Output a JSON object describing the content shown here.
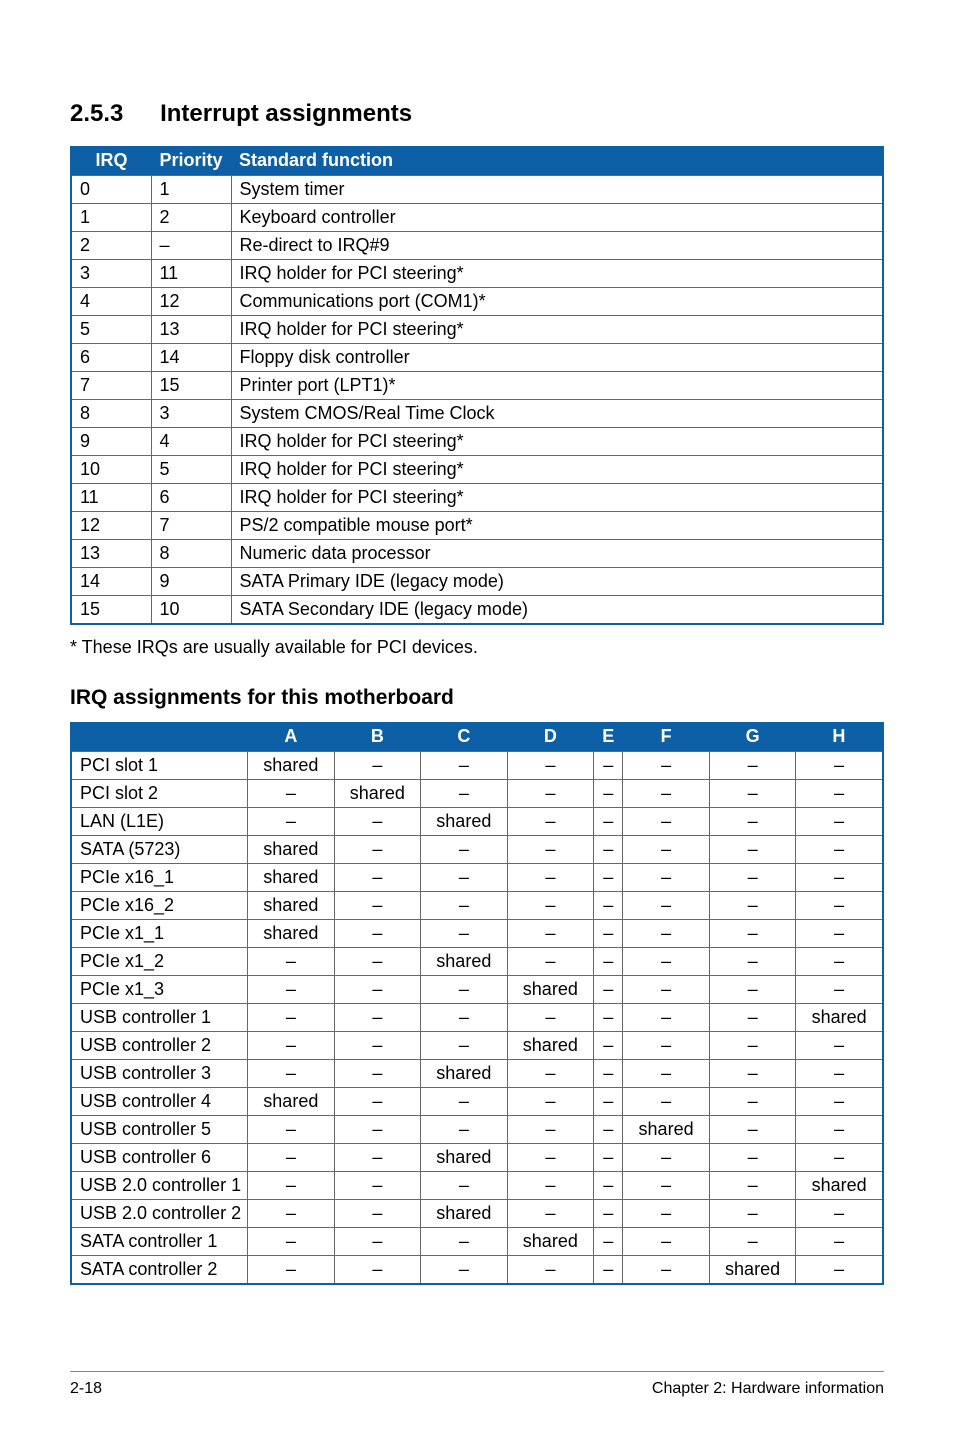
{
  "section": {
    "number": "2.5.3",
    "title": "Interrupt assignments"
  },
  "irq_table": {
    "headers": {
      "irq": "IRQ",
      "priority": "Priority",
      "func": "Standard function"
    },
    "rows": [
      {
        "irq": "0",
        "priority": "1",
        "func": "System timer"
      },
      {
        "irq": "1",
        "priority": "2",
        "func": "Keyboard controller"
      },
      {
        "irq": "2",
        "priority": "–",
        "func": "Re-direct to IRQ#9"
      },
      {
        "irq": "3",
        "priority": "11",
        "func": "IRQ holder for PCI steering*"
      },
      {
        "irq": "4",
        "priority": "12",
        "func": "Communications port (COM1)*"
      },
      {
        "irq": "5",
        "priority": "13",
        "func": "IRQ holder for PCI steering*"
      },
      {
        "irq": "6",
        "priority": "14",
        "func": "Floppy disk controller"
      },
      {
        "irq": "7",
        "priority": "15",
        "func": "Printer port (LPT1)*"
      },
      {
        "irq": "8",
        "priority": "3",
        "func": "System CMOS/Real Time Clock"
      },
      {
        "irq": "9",
        "priority": "4",
        "func": "IRQ holder for PCI steering*"
      },
      {
        "irq": "10",
        "priority": "5",
        "func": "IRQ holder for PCI steering*"
      },
      {
        "irq": "11",
        "priority": "6",
        "func": "IRQ holder for PCI steering*"
      },
      {
        "irq": "12",
        "priority": "7",
        "func": "PS/2 compatible mouse port*"
      },
      {
        "irq": "13",
        "priority": "8",
        "func": "Numeric data processor"
      },
      {
        "irq": "14",
        "priority": "9",
        "func": "SATA Primary IDE (legacy mode)"
      },
      {
        "irq": "15",
        "priority": "10",
        "func": "SATA Secondary IDE (legacy mode)"
      }
    ]
  },
  "footnote": "* These IRQs are usually available for PCI devices.",
  "subheading": "IRQ assignments for this motherboard",
  "assign_table": {
    "cols": [
      "A",
      "B",
      "C",
      "D",
      "E",
      "F",
      "G",
      "H"
    ],
    "rows": [
      {
        "label": "PCI slot 1",
        "cells": [
          "shared",
          "–",
          "–",
          "–",
          "–",
          "–",
          "–",
          "–"
        ]
      },
      {
        "label": "PCI slot 2",
        "cells": [
          "–",
          "shared",
          "–",
          "–",
          "–",
          "–",
          "–",
          "–"
        ]
      },
      {
        "label": "LAN (L1E)",
        "cells": [
          "–",
          "–",
          "shared",
          "–",
          "–",
          "–",
          "–",
          "–"
        ]
      },
      {
        "label": "SATA (5723)",
        "cells": [
          "shared",
          "–",
          "–",
          "–",
          "–",
          "–",
          "–",
          "–"
        ]
      },
      {
        "label": "PCIe x16_1",
        "cells": [
          "shared",
          "–",
          "–",
          "–",
          "–",
          "–",
          "–",
          "–"
        ]
      },
      {
        "label": "PCIe x16_2",
        "cells": [
          "shared",
          "–",
          "–",
          "–",
          "–",
          "–",
          "–",
          "–"
        ]
      },
      {
        "label": "PCIe x1_1",
        "cells": [
          "shared",
          "–",
          "–",
          "–",
          "–",
          "–",
          "–",
          "–"
        ]
      },
      {
        "label": "PCIe x1_2",
        "cells": [
          "–",
          "–",
          "shared",
          "–",
          "–",
          "–",
          "–",
          "–"
        ]
      },
      {
        "label": "PCIe x1_3",
        "cells": [
          "–",
          "–",
          "–",
          "shared",
          "–",
          "–",
          "–",
          "–"
        ]
      },
      {
        "label": "USB controller 1",
        "cells": [
          "–",
          "–",
          "–",
          "–",
          "–",
          "–",
          "–",
          "shared"
        ]
      },
      {
        "label": "USB controller 2",
        "cells": [
          "–",
          "–",
          "–",
          "shared",
          "–",
          "–",
          "–",
          "–"
        ]
      },
      {
        "label": "USB controller 3",
        "cells": [
          "–",
          "–",
          "shared",
          "–",
          "–",
          "–",
          "–",
          "–"
        ]
      },
      {
        "label": "USB controller 4",
        "cells": [
          "shared",
          "–",
          "–",
          "–",
          "–",
          "–",
          "–",
          "–"
        ]
      },
      {
        "label": "USB controller 5",
        "cells": [
          "–",
          "–",
          "–",
          "–",
          "–",
          "shared",
          "–",
          "–"
        ]
      },
      {
        "label": "USB controller 6",
        "cells": [
          "–",
          "–",
          "shared",
          "–",
          "–",
          "–",
          "–",
          "–"
        ]
      },
      {
        "label": "USB 2.0 controller 1",
        "cells": [
          "–",
          "–",
          "–",
          "–",
          "–",
          "–",
          "–",
          "shared"
        ]
      },
      {
        "label": "USB 2.0 controller 2",
        "cells": [
          "–",
          "–",
          "shared",
          "–",
          "–",
          "–",
          "–",
          "–"
        ]
      },
      {
        "label": "SATA controller 1",
        "cells": [
          "–",
          "–",
          "–",
          "shared",
          "–",
          "–",
          "–",
          "–"
        ]
      },
      {
        "label": "SATA controller 2",
        "cells": [
          "–",
          "–",
          "–",
          "–",
          "–",
          "–",
          "shared",
          "–"
        ]
      }
    ]
  },
  "footer": {
    "left": "2-18",
    "right": "Chapter 2: Hardware information"
  }
}
